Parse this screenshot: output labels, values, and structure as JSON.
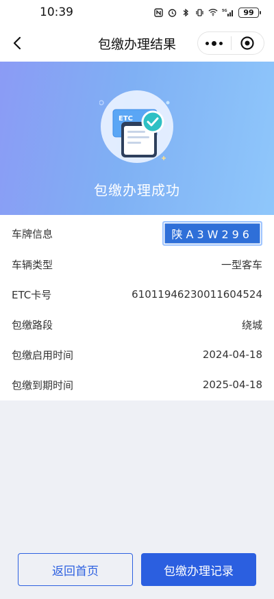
{
  "status_bar": {
    "time": "10:39",
    "network": "5G",
    "battery": "99",
    "icons": [
      "nfc-icon",
      "alarm-icon",
      "bluetooth-icon",
      "vibrate-icon",
      "wifi-icon",
      "signal-icon",
      "battery-icon"
    ]
  },
  "nav": {
    "title": "包缴办理结果",
    "back_icon": "chevron-left-icon",
    "more_icon": "more-dots-icon",
    "close_icon": "target-close-icon"
  },
  "hero": {
    "card_label": "ETC",
    "message": "包缴办理成功",
    "colors": {
      "gradient_start": "#8b9bf5",
      "gradient_end": "#8fc7fb"
    }
  },
  "info": {
    "rows": [
      {
        "label": "车牌信息",
        "value": "陕A3W296"
      },
      {
        "label": "车辆类型",
        "value": "一型客车"
      },
      {
        "label": "ETC卡号",
        "value": "61011946230011604524"
      },
      {
        "label": "包缴路段",
        "value": "绕城"
      },
      {
        "label": "包缴启用时间",
        "value": "2024-04-18"
      },
      {
        "label": "包缴到期时间",
        "value": "2025-04-18"
      }
    ]
  },
  "buttons": {
    "home_label": "返回首页",
    "records_label": "包缴办理记录"
  },
  "colors": {
    "accent": "#2b5fe0",
    "plate_blue": "#2f6fd8"
  }
}
